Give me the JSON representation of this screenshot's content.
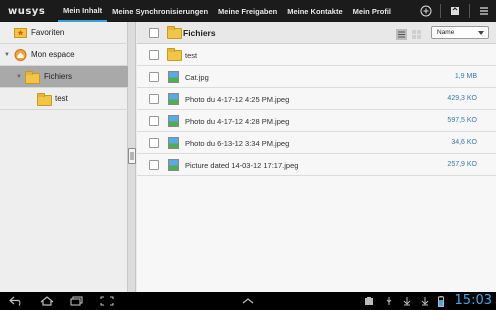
{
  "app": {
    "logo": "wusys"
  },
  "tabs": [
    "Mein Inhalt",
    "Meine Synchronisierungen",
    "Meine Freigaben",
    "Meine Kontakte",
    "Mein Profil"
  ],
  "top_icons": [
    "add-icon",
    "upload-icon",
    "menu-icon"
  ],
  "tree": {
    "items": [
      {
        "label": "Favoriten",
        "icon": "star-folder-icon"
      },
      {
        "label": "Mon espace",
        "icon": "home-icon"
      },
      {
        "label": "Fichiers",
        "icon": "folder-icon",
        "selected": true
      },
      {
        "label": "test",
        "icon": "folder-icon"
      }
    ]
  },
  "main": {
    "header_title": "Fichiers",
    "sort_label": "Name"
  },
  "files": [
    {
      "name": "test",
      "size": "",
      "type": "folder"
    },
    {
      "name": "Cat.jpg",
      "size": "1,9 MB",
      "type": "image"
    },
    {
      "name": "Photo du 4-17-12 4:25 PM.jpeg",
      "size": "429,3 KO",
      "type": "image"
    },
    {
      "name": "Photo du 4-17-12 4:28 PM.jpeg",
      "size": "597,5 KO",
      "type": "image"
    },
    {
      "name": "Photo du 6-13-12 3:34 PM.jpeg",
      "size": "34,6 KO",
      "type": "image"
    },
    {
      "name": "Picture dated 14-03-12 17:17.jpeg",
      "size": "257,9 KO",
      "type": "image"
    }
  ],
  "status": {
    "time": "15:03"
  },
  "colors": {
    "accent": "#3aa0d8",
    "size_text": "#3b78b0",
    "topbar": "#1b1b1b"
  }
}
